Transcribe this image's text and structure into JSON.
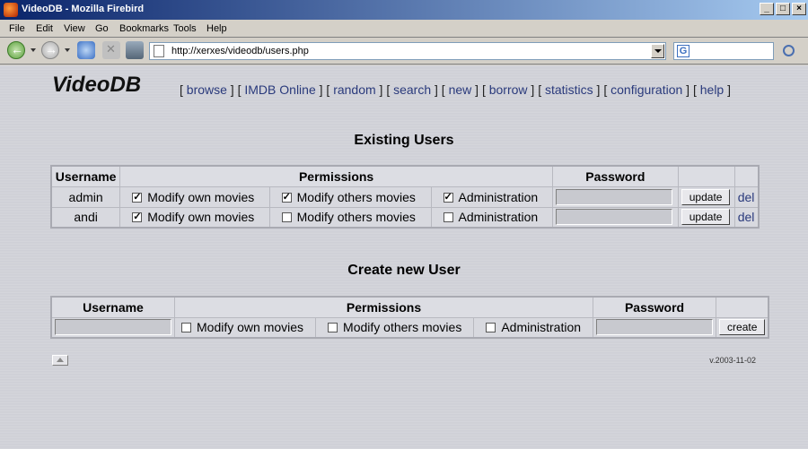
{
  "window": {
    "title": "VideoDB - Mozilla Firebird",
    "controls": [
      "_",
      "□",
      "×"
    ]
  },
  "menu": [
    "File",
    "Edit",
    "View",
    "Go",
    "Bookmarks",
    "Tools",
    "Help"
  ],
  "navbar": {
    "url": "http://xerxes/videodb/users.php",
    "search_engine_letter": "G"
  },
  "page": {
    "logo": "VideoDB",
    "nav_links": [
      "browse",
      "IMDB Online",
      "random",
      "search",
      "new",
      "borrow",
      "statistics",
      "configuration",
      "help"
    ],
    "existing_title": "Existing Users",
    "existing_headers": {
      "username": "Username",
      "permissions": "Permissions",
      "password": "Password"
    },
    "users": [
      {
        "name": "admin",
        "perms": [
          {
            "label": "Modify own movies",
            "checked": true
          },
          {
            "label": "Modify others movies",
            "checked": true
          },
          {
            "label": "Administration",
            "checked": true
          }
        ],
        "update": "update",
        "delete": "del"
      },
      {
        "name": "andi",
        "perms": [
          {
            "label": "Modify own movies",
            "checked": true
          },
          {
            "label": "Modify others movies",
            "checked": false
          },
          {
            "label": "Administration",
            "checked": false
          }
        ],
        "update": "update",
        "delete": "del"
      }
    ],
    "create_title": "Create new User",
    "create_headers": {
      "username": "Username",
      "permissions": "Permissions",
      "password": "Password"
    },
    "create_perms": [
      "Modify own movies",
      "Modify others movies",
      "Administration"
    ],
    "create_button": "create",
    "version": "v.2003-11-02"
  }
}
